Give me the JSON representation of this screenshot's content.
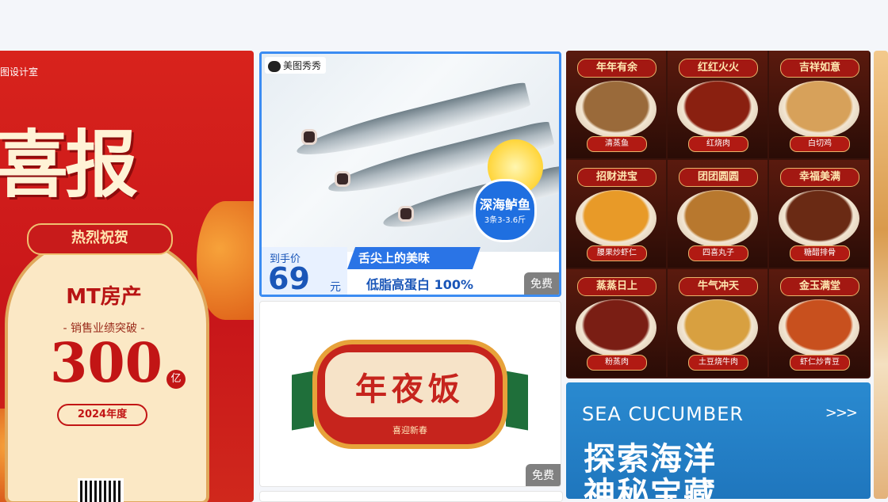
{
  "cards": {
    "xibao": {
      "studio": "图设计室",
      "headline": "喜报",
      "ribbon": "热烈祝贺",
      "company": "MT房产",
      "subline": "- 销售业绩突破 -",
      "number": "300",
      "unit": "亿",
      "year": "2024年度"
    },
    "fish": {
      "logo": "美图秀秀",
      "badge_title": "深海鲈鱼",
      "badge_sub": "3条3-3.6斤",
      "price_label": "到手价",
      "price": "69",
      "price_unit": "元",
      "slogan1": "舌尖上的美味",
      "slogan2": "低脂高蛋白 100%",
      "free_tag": "免费"
    },
    "nianyefan": {
      "title": "年夜饭",
      "subtitle": "喜迎新春",
      "free_tag": "免费"
    },
    "menu": {
      "cells": [
        {
          "title": "年年有余",
          "name": "清蒸鱼",
          "color": "#9a6a3a"
        },
        {
          "title": "红红火火",
          "name": "红烧肉",
          "color": "#8a2010"
        },
        {
          "title": "吉祥如意",
          "name": "白切鸡",
          "color": "#d7a15a"
        },
        {
          "title": "招财进宝",
          "name": "腰果炒虾仁",
          "color": "#e89a28"
        },
        {
          "title": "团团圆圆",
          "name": "四喜丸子",
          "color": "#b8782e"
        },
        {
          "title": "幸福美满",
          "name": "糖醋排骨",
          "color": "#6a2a14"
        },
        {
          "title": "蒸蒸日上",
          "name": "粉蒸肉",
          "color": "#7a1e14"
        },
        {
          "title": "牛气冲天",
          "name": "土豆烧牛肉",
          "color": "#d8a040"
        },
        {
          "title": "金玉满堂",
          "name": "虾仁炒青豆",
          "color": "#c8501e"
        }
      ]
    },
    "sea": {
      "en_title": "SEA CUCUMBER",
      "arrows": ">>>",
      "zh_line1": "探索海洋",
      "zh_line2": "神秘宝藏"
    }
  },
  "colors": {
    "page_bg": "#f4f6fa",
    "fish_border": "#3b8cf2",
    "brand_red": "#c8161a",
    "sea_blue": "#2a8ad0"
  }
}
